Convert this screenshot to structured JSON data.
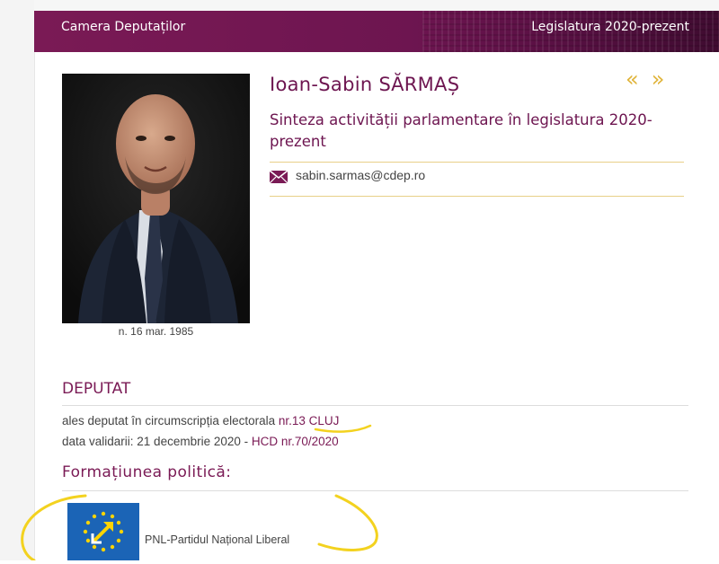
{
  "header": {
    "site_title": "Camera Deputaților",
    "legislature": "Legislatura 2020-prezent"
  },
  "profile": {
    "name": "Ioan-Sabin SĂRMAȘ",
    "subtitle": "Sinteza activității parlamentare în legislatura 2020-prezent",
    "email": "sabin.sarmas@cdep.ro",
    "birth": "n. 16 mar. 1985",
    "nav_prev": "«",
    "nav_next": "»"
  },
  "mandate": {
    "title": "DEPUTAT",
    "elected_prefix": "ales deputat în circumscripția electorala ",
    "district_link": "nr.13 CLUJ",
    "validation_prefix": "data validarii: 21 decembrie 2020 - ",
    "validation_link": "HCD nr.70/2020"
  },
  "party": {
    "section_title": "Formațiunea politică:",
    "name": "PNL-Partidul Național Liberal",
    "logo_color": "#1b64b6"
  },
  "colors": {
    "accent": "#6d1550",
    "highlight": "#e0b43a"
  }
}
